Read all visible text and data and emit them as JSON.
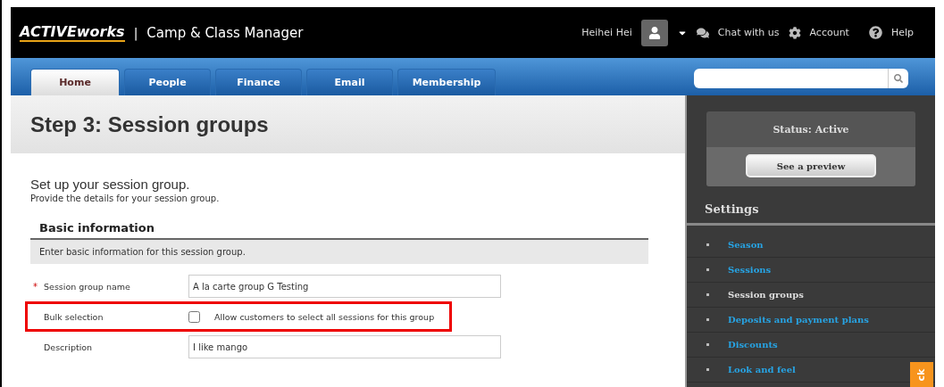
{
  "header": {
    "logo": "ACTIVEworks",
    "product": "Camp & Class Manager",
    "user": "Heihei Hei",
    "chat": "Chat with us",
    "account": "Account",
    "help": "Help"
  },
  "tabs": [
    {
      "label": "Home",
      "selected": true
    },
    {
      "label": "People",
      "selected": false
    },
    {
      "label": "Finance",
      "selected": false
    },
    {
      "label": "Email",
      "selected": false
    },
    {
      "label": "Membership",
      "selected": false
    }
  ],
  "separator": "|",
  "page": {
    "title": "Step 3: Session groups",
    "intro": "Set up your session group.",
    "subintro": "Provide the details for your session group.",
    "section": "Basic information",
    "section_note": "Enter basic information for this session group.",
    "required_mark": "*",
    "fields": [
      {
        "kind": "text",
        "label": "Session group name",
        "required": true,
        "value": "A la carte group G Testing",
        "highlighted": false
      },
      {
        "kind": "checkbox",
        "label": "Bulk selection",
        "required": false,
        "checked": false,
        "option": "Allow customers to select all sessions for this group",
        "highlighted": true
      },
      {
        "kind": "text",
        "label": "Description",
        "required": false,
        "value": "I like mango",
        "highlighted": false
      }
    ]
  },
  "sidebar": {
    "status": "Status: Active",
    "preview": "See a preview",
    "settings_title": "Settings",
    "items": [
      {
        "label": "Season",
        "selected": false
      },
      {
        "label": "Sessions",
        "selected": false
      },
      {
        "label": "Session groups",
        "selected": true
      },
      {
        "label": "Deposits and payment plans",
        "selected": false
      },
      {
        "label": "Discounts",
        "selected": false
      },
      {
        "label": "Look and feel",
        "selected": false
      }
    ]
  },
  "feedback": "ck"
}
